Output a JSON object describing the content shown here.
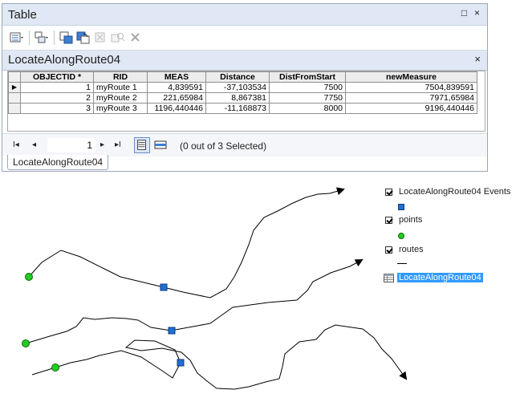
{
  "window": {
    "title": "Table",
    "float_icon": "□",
    "close_icon": "×"
  },
  "toolbar": {
    "icons": [
      "table-options-icon",
      "related-tables-icon",
      "select-by-attributes-icon",
      "switch-selection-icon",
      "clear-selection-icon",
      "zoom-to-selected-icon",
      "delete-selected-icon"
    ]
  },
  "tab": {
    "title": "LocateAlongRoute04",
    "close": "×"
  },
  "table": {
    "columns": [
      "OBJECTID *",
      "RID",
      "MEAS",
      "Distance",
      "DistFromStart",
      "newMeasure"
    ],
    "rows": [
      [
        "1",
        "myRoute 1",
        "4,839591",
        "-37,103534",
        "7500",
        "7504,839591"
      ],
      [
        "2",
        "myRoute 2",
        "221,65984",
        "8,867381",
        "7750",
        "7971,65984"
      ],
      [
        "3",
        "myRoute 3",
        "1196,440446",
        "-11,168873",
        "8000",
        "9196,440446"
      ]
    ],
    "current_row_marker": "▶"
  },
  "navigation": {
    "first": "I◂",
    "prev": "◂",
    "page": "1",
    "next": "▸",
    "last": "▸I",
    "selection_status": "(0 out of 3 Selected)"
  },
  "bottom_tab": "LocateAlongRoute04",
  "toc": {
    "layers": [
      {
        "name": "LocateAlongRoute04 Events",
        "symbol": "blue-square"
      },
      {
        "name": "points",
        "symbol": "green-circle"
      },
      {
        "name": "routes",
        "symbol": "black-line"
      },
      {
        "name": "LocateAlongRoute04",
        "symbol": "table-icon"
      }
    ]
  },
  "colors": {
    "event_marker": "#1f6fd6",
    "point_marker": "#22cc22",
    "selected_highlight": "#3399ff",
    "title_bar": "#dfe8f4"
  }
}
